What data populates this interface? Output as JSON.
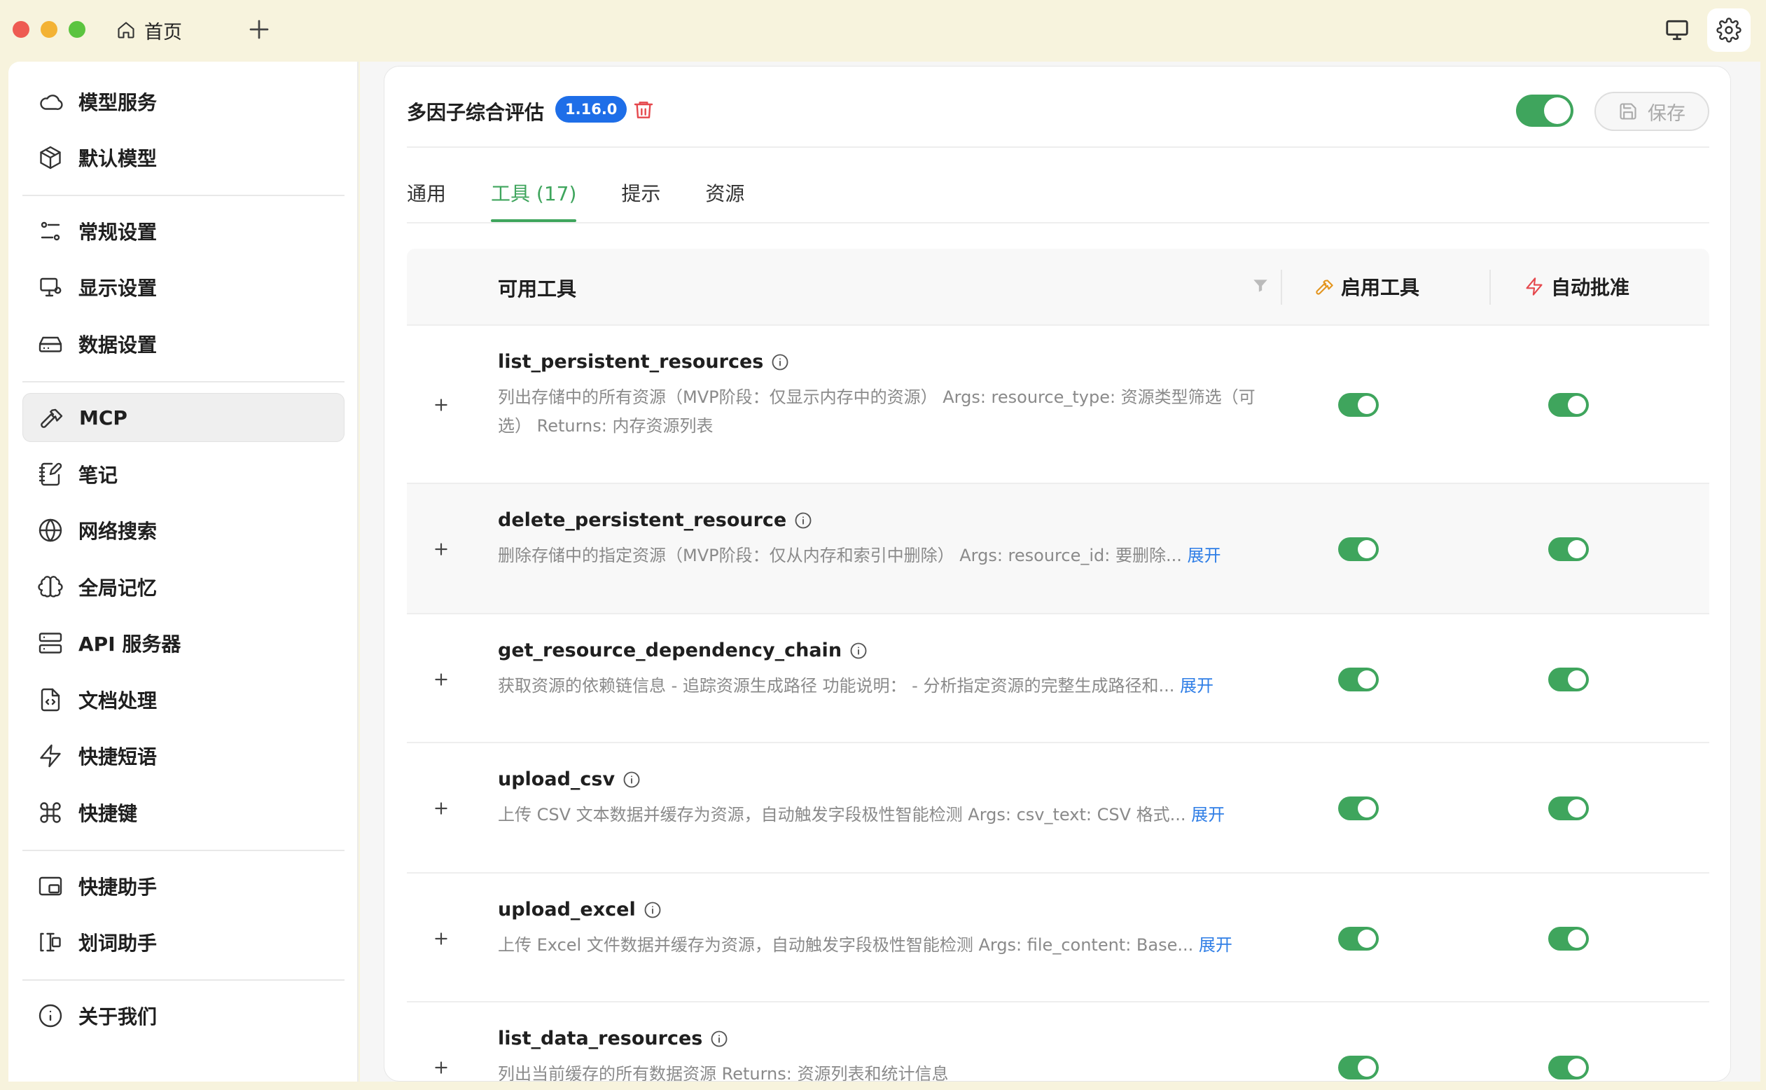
{
  "titlebar": {
    "home_tab_label": "首页"
  },
  "sidebar": {
    "groups": [
      [
        {
          "label": "模型服务",
          "icon": "cloud-icon"
        },
        {
          "label": "默认模型",
          "icon": "cube-icon"
        }
      ],
      [
        {
          "label": "常规设置",
          "icon": "sliders-icon"
        },
        {
          "label": "显示设置",
          "icon": "display-icon"
        },
        {
          "label": "数据设置",
          "icon": "hard-drive-icon"
        }
      ],
      [
        {
          "label": "MCP",
          "icon": "hammer-icon",
          "active": true
        },
        {
          "label": "笔记",
          "icon": "notebook-pen-icon"
        },
        {
          "label": "网络搜索",
          "icon": "globe-icon"
        },
        {
          "label": "全局记忆",
          "icon": "brain-icon"
        },
        {
          "label": "API 服务器",
          "icon": "server-icon"
        },
        {
          "label": "文档处理",
          "icon": "file-code-icon"
        },
        {
          "label": "快捷短语",
          "icon": "zap-icon"
        },
        {
          "label": "快捷键",
          "icon": "command-icon"
        }
      ],
      [
        {
          "label": "快捷助手",
          "icon": "app-window-icon"
        },
        {
          "label": "划词助手",
          "icon": "text-cursor-icon"
        }
      ],
      [
        {
          "label": "关于我们",
          "icon": "info-icon"
        }
      ]
    ]
  },
  "server": {
    "name": "多因子综合评估",
    "version": "1.16.0",
    "enabled": true,
    "save_label": "保存"
  },
  "tabs": [
    {
      "label": "通用",
      "active": false
    },
    {
      "label": "工具 (17)",
      "active": true
    },
    {
      "label": "提示",
      "active": false
    },
    {
      "label": "资源",
      "active": false
    }
  ],
  "table": {
    "title": "可用工具",
    "col_enable": "启用工具",
    "col_auto": "自动批准",
    "expand_label": "展开",
    "rows": [
      {
        "name": "list_persistent_resources",
        "desc": "列出存储中的所有资源（MVP阶段：仅显示内存中的资源） Args: resource_type: 资源类型筛选（可选） Returns: 内存资源列表",
        "truncated": false,
        "enabled": true,
        "auto": true
      },
      {
        "name": "delete_persistent_resource",
        "desc": "删除存储中的指定资源（MVP阶段：仅从内存和索引中删除） Args: resource_id: 要删除...",
        "truncated": true,
        "enabled": true,
        "auto": true
      },
      {
        "name": "get_resource_dependency_chain",
        "desc": "获取资源的依赖链信息 - 追踪资源生成路径 功能说明： - 分析指定资源的完整生成路径和...",
        "truncated": true,
        "enabled": true,
        "auto": true
      },
      {
        "name": "upload_csv",
        "desc": "上传 CSV 文本数据并缓存为资源，自动触发字段极性智能检测 Args: csv_text: CSV 格式...",
        "truncated": true,
        "enabled": true,
        "auto": true
      },
      {
        "name": "upload_excel",
        "desc": "上传 Excel 文件数据并缓存为资源，自动触发字段极性智能检测 Args: file_content: Base...",
        "truncated": true,
        "enabled": true,
        "auto": true
      },
      {
        "name": "list_data_resources",
        "desc": "列出当前缓存的所有数据资源 Returns: 资源列表和统计信息",
        "truncated": false,
        "enabled": true,
        "auto": true
      }
    ]
  }
}
